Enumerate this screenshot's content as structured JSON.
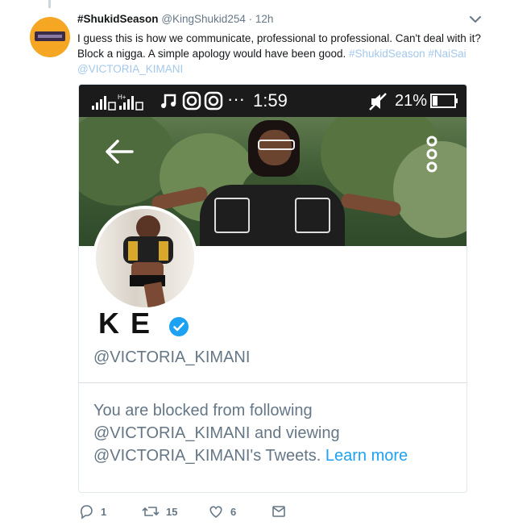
{
  "tweet": {
    "display_name": "#ShukidSeason",
    "handle": "@KingShukid254",
    "separator": "·",
    "time": "12h",
    "text_main": "I guess this is how we communicate, professional to professional. Can't deal with it? Block a nigga. A simple apology would have been good.",
    "hashtag1": "#ShukidSeason",
    "hashtag2": "#NaiSai",
    "mention": "@VICTORIA_KIMANI",
    "caret_icon": "chevron-down-icon"
  },
  "screenshot": {
    "status_bar": {
      "time": "1:59",
      "battery": "21%",
      "more": "···"
    },
    "profile": {
      "name": "K E",
      "handle": "@VICTORIA_KIMANI",
      "blocked_text": "You are blocked from following @VICTORIA_KIMANI and viewing @VICTORIA_KIMANI's Tweets.",
      "learn_more": "Learn more"
    }
  },
  "actions": {
    "reply_count": "1",
    "retweet_count": "15",
    "like_count": "6"
  },
  "colors": {
    "accent": "#1da1f2",
    "hashtag": "#a4c8ec",
    "text_secondary": "#657786",
    "avatar_bg": "#f5a623"
  }
}
